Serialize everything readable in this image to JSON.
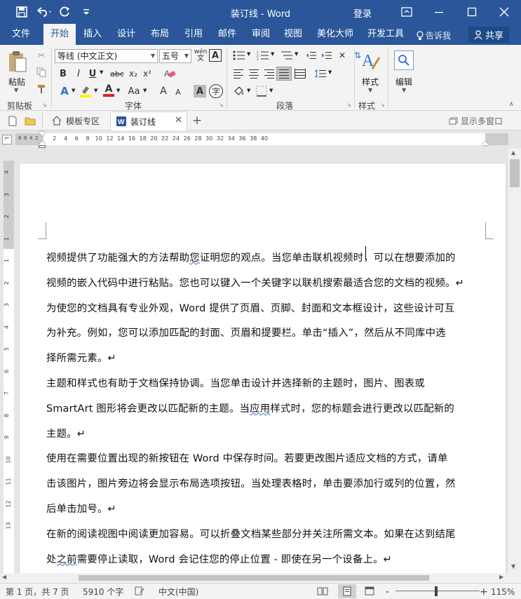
{
  "window": {
    "title": "装订线 - Word",
    "login_label": "登录"
  },
  "ribbon_tabs": {
    "file": "文件",
    "home": "开始",
    "insert": "插入",
    "design": "设计",
    "layout": "布局",
    "references": "引用",
    "mailings": "邮件",
    "review": "审阅",
    "view": "视图",
    "beautify": "美化大师",
    "developer": "开发工具",
    "tell_me": "告诉我",
    "share": "共享"
  },
  "ribbon": {
    "paste_label": "粘贴",
    "clipboard_group": "剪贴板",
    "font_name": "等线 (中文正文)",
    "font_size": "五号",
    "font_group": "字体",
    "paragraph_group": "段落",
    "styles_label": "样式",
    "styles_group": "样式",
    "edit_label": "编辑",
    "bold": "B",
    "italic": "I",
    "underline": "U",
    "strike": "abc",
    "sub": "x₂",
    "sup": "x²",
    "case": "Aa",
    "grow": "A",
    "shrink": "A",
    "wen": "wén",
    "char_border": "A",
    "char_shade": "A",
    "enclose": "字",
    "font_color": "A",
    "text_effect": "A"
  },
  "doc_tabs": {
    "template": "模板专区",
    "current": "装订线",
    "multi_window": "显示多窗口"
  },
  "ruler": {
    "left_marks": [
      "8",
      "6",
      "4",
      "2"
    ],
    "marks": [
      "2",
      "4",
      "6",
      "8",
      "10",
      "12",
      "14",
      "16",
      "18",
      "20",
      "22",
      "24",
      "26",
      "28",
      "30",
      "32",
      "34",
      "36",
      "38",
      "40"
    ],
    "v_marks": [
      "4",
      "3",
      "2",
      "1",
      "1",
      "2",
      "3",
      "4",
      "5",
      "6",
      "7",
      "8",
      "9",
      "10",
      "11",
      "12",
      "13"
    ]
  },
  "document": {
    "lines": [
      [
        "视频提供了功能强大的方法帮助",
        "您",
        "证明您的观点。当您单击联机视频时，可以在想要添加的"
      ],
      [
        "视频的嵌入代码中进行粘贴。您也可以键入一个关键字以联机搜索最适合您的文档的视频。↵"
      ],
      [
        "为使您的文档具有专业外观，Word 提供了页眉、页脚、封面和文本框设计，这些设计可互"
      ],
      [
        "为补充。例如，您可以添加匹配的封面、页眉和提要栏。单击“插入”，然后从不同库中选"
      ],
      [
        "择所需元素。↵"
      ],
      [
        "主题和样式也有助于文档保持协调。当您单击设计并选择新的主题时，图片、图表或"
      ],
      [
        "SmartArt 图形将会更改以匹配新的主题。当",
        "应用",
        "样式时，您的标题会进行更改以匹配新的"
      ],
      [
        "主题。↵"
      ],
      [
        "使用在需要位置出现的新按钮在 Word 中保存时间。若要更改图片适应文档的方式，请单"
      ],
      [
        "击该图片，图片旁边将会显示布局选项按钮。当处理表格时，单击要添加行或列的位置，然"
      ],
      [
        "后单击加号。↵"
      ],
      [
        "在新的阅读视图中阅读更加容易。可以折叠文档某些部分并关注所需文本。如果在达到结尾"
      ],
      [
        "处",
        "之前",
        "需要停止读取，Word 会记住您的停止位置 - 即使在另一个设备上。↵"
      ]
    ]
  },
  "status": {
    "page": "第 1 页，共 7 页",
    "words": "5910 个字",
    "language": "中文(中国)",
    "zoom": "115%",
    "minus": "-",
    "plus": "+"
  }
}
